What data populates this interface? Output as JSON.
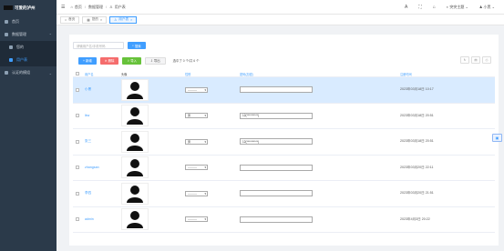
{
  "brand": {
    "title": "可爱的泸州"
  },
  "sidebar": {
    "items": [
      {
        "label": "首页",
        "icon": "home-icon"
      },
      {
        "label": "数据管理",
        "icon": "database-icon",
        "caret": "⌃"
      },
      {
        "label": "您的",
        "icon": "grid-icon"
      },
      {
        "label": "用户表",
        "icon": "user-icon"
      },
      {
        "label": "认证的模组",
        "icon": "shield-icon",
        "caret": "⌄"
      }
    ]
  },
  "topbar": {
    "crumbs": [
      "首页",
      "数据管理",
      "用户表"
    ],
    "theme_label": "突突主题",
    "user_label": "小黑"
  },
  "tags": [
    {
      "label": "首页"
    },
    {
      "label": "您的"
    },
    {
      "label": "用户表"
    }
  ],
  "search": {
    "placeholder": "请输用户名/手机号码",
    "button_label": "搜索"
  },
  "toolbar": {
    "add_label": "新增",
    "delete_label": "删除",
    "import_label": "导入",
    "export_label": "导出",
    "selection_info": "选中了 0 个/共 6 个"
  },
  "table": {
    "headers": [
      "用户名",
      "头像",
      "性别",
      "密码(加密)",
      "注册时间"
    ],
    "rows": [
      {
        "name": "小黑",
        "gender": "----------",
        "password": "",
        "time": "2023年03月18日 10:17",
        "selected": true
      },
      {
        "name": "lkw",
        "gender": "男",
        "password": "12(**********)",
        "time": "2023年03月18日 20:51",
        "selected": false
      },
      {
        "name": "张三",
        "gender": "男",
        "password": "12(**********)",
        "time": "2023年03月18日 20:51",
        "selected": false
      },
      {
        "name": "zhangsan",
        "gender": "----------",
        "password": "",
        "time": "2023年03月20日 22:11",
        "selected": false
      },
      {
        "name": "李四",
        "gender": "----------",
        "password": "",
        "time": "2023年03月20日 21:51",
        "selected": false
      },
      {
        "name": "admin",
        "gender": "----------",
        "password": "",
        "time": "2023年4月3日 20:22",
        "selected": false
      }
    ]
  }
}
